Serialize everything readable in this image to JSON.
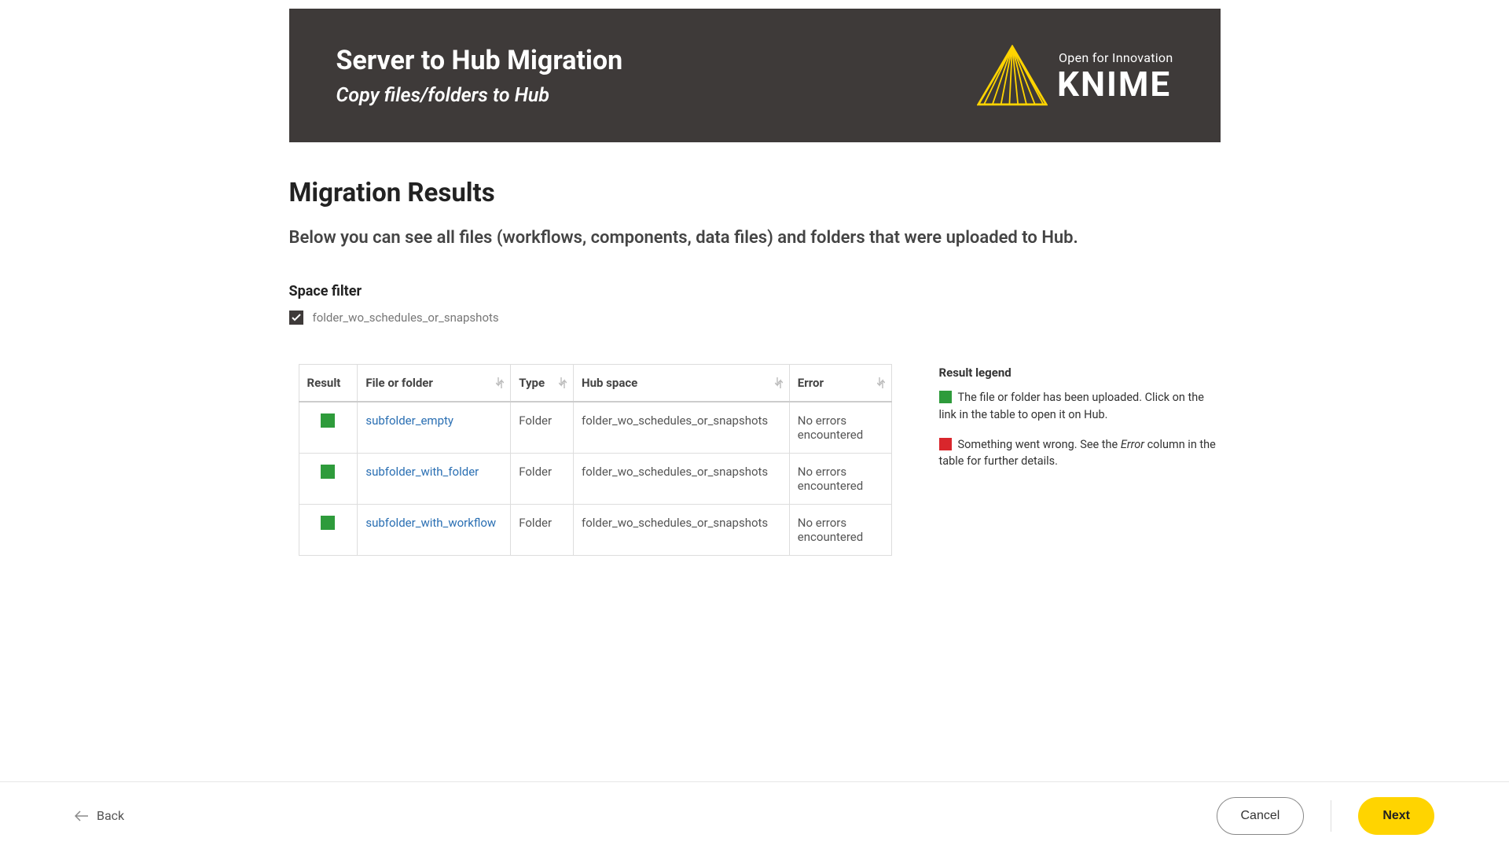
{
  "banner": {
    "title": "Server to Hub Migration",
    "subtitle": "Copy files/folders to Hub",
    "logo_tagline": "Open for Innovation",
    "logo_name": "KNIME"
  },
  "page": {
    "title": "Migration Results",
    "intro": "Below you can see all files (workflows, components, data files) and folders that were uploaded to Hub."
  },
  "filter": {
    "title": "Space filter",
    "options": [
      {
        "label": "folder_wo_schedules_or_snapshots",
        "checked": true
      }
    ]
  },
  "table": {
    "columns": {
      "result": "Result",
      "file": "File or folder",
      "type": "Type",
      "space": "Hub space",
      "error": "Error"
    },
    "rows": [
      {
        "result": "success",
        "file": "subfolder_empty",
        "type": "Folder",
        "space": "folder_wo_schedules_or_snapshots",
        "error": "No errors encountered"
      },
      {
        "result": "success",
        "file": "subfolder_with_folder",
        "type": "Folder",
        "space": "folder_wo_schedules_or_snapshots",
        "error": "No errors encountered"
      },
      {
        "result": "success",
        "file": "subfolder_with_workflow",
        "type": "Folder",
        "space": "folder_wo_schedules_or_snapshots",
        "error": "No errors encountered"
      }
    ]
  },
  "legend": {
    "title": "Result legend",
    "success_text": "The file or folder has been uploaded. Click on the link in the table to open it on Hub.",
    "error_prefix": "Something went wrong. See the ",
    "error_em": "Error",
    "error_suffix": " column in the table for further details."
  },
  "footer": {
    "back": "Back",
    "cancel": "Cancel",
    "next": "Next"
  },
  "colors": {
    "success": "#2e9b3b",
    "error": "#d9262c",
    "accent": "#ffd400"
  }
}
